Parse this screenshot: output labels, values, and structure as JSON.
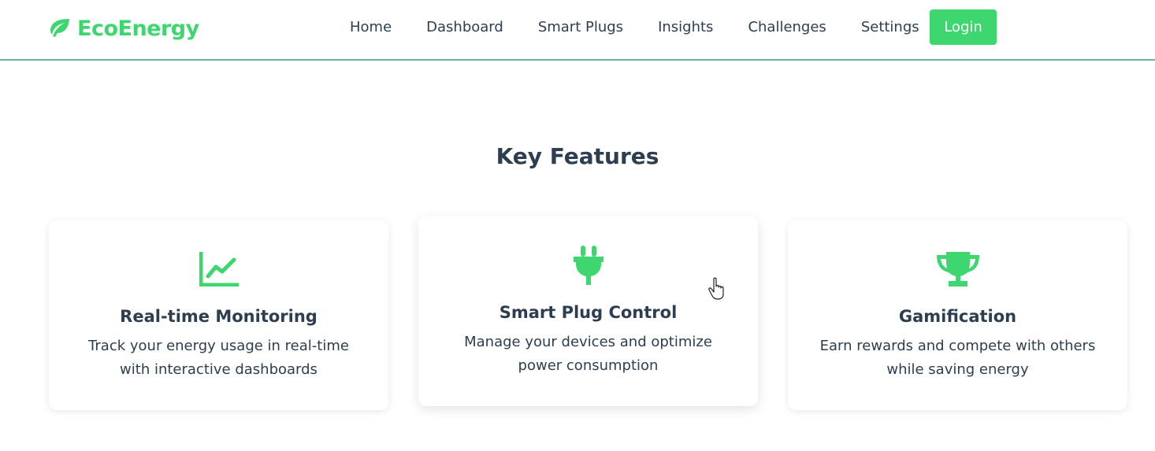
{
  "brand": {
    "name": "EcoEnergy",
    "icon": "leaf-icon",
    "color": "#3dd66f"
  },
  "nav": {
    "links": [
      "Home",
      "Dashboard",
      "Smart Plugs",
      "Insights",
      "Challenges",
      "Settings"
    ],
    "login_label": "Login"
  },
  "features": {
    "title": "Key Features",
    "cards": [
      {
        "icon": "chart-line-icon",
        "title": "Real-time Monitoring",
        "description": "Track your energy usage in real-time with interactive dashboards"
      },
      {
        "icon": "plug-icon",
        "title": "Smart Plug Control",
        "description": "Manage your devices and optimize power consumption"
      },
      {
        "icon": "trophy-icon",
        "title": "Gamification",
        "description": "Earn rewards and compete with others while saving energy"
      }
    ]
  },
  "colors": {
    "accent": "#3dd66f",
    "text": "#2c3e50",
    "divider": "#5fb3a8"
  }
}
